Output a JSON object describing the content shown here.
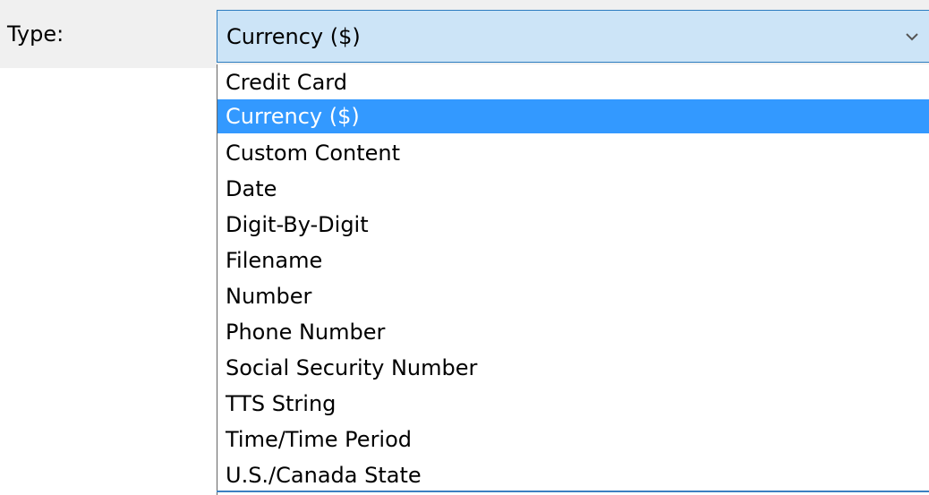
{
  "field": {
    "label": "Type:"
  },
  "combo": {
    "selected_value": "Currency ($)",
    "arrow_icon": "chevron-down-icon"
  },
  "dropdown": {
    "options": [
      {
        "label": "Credit Card",
        "selected": false
      },
      {
        "label": "Currency ($)",
        "selected": true
      },
      {
        "label": "Custom Content",
        "selected": false
      },
      {
        "label": "Date",
        "selected": false
      },
      {
        "label": "Digit-By-Digit",
        "selected": false
      },
      {
        "label": "Filename",
        "selected": false
      },
      {
        "label": "Number",
        "selected": false
      },
      {
        "label": "Phone Number",
        "selected": false
      },
      {
        "label": "Social Security Number",
        "selected": false
      },
      {
        "label": "TTS String",
        "selected": false
      },
      {
        "label": "Time/Time Period",
        "selected": false
      },
      {
        "label": "U.S./Canada State",
        "selected": false
      }
    ]
  },
  "colors": {
    "combo_background": "#cce4f7",
    "combo_border": "#2d7dc0",
    "selected_option": "#3399ff",
    "form_background": "#f0f0f0"
  }
}
